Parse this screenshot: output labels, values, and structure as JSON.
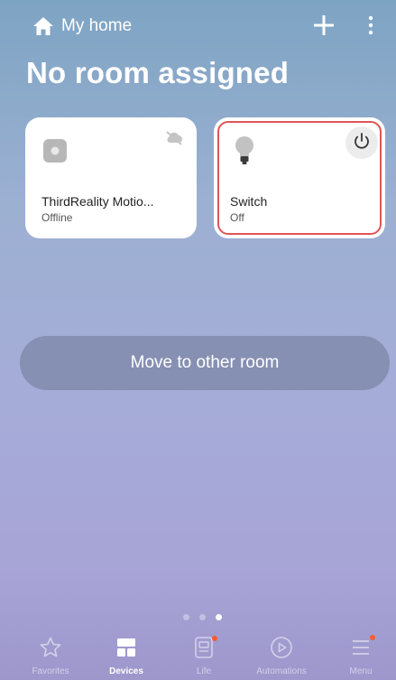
{
  "header": {
    "home_label": "My home",
    "title": "No room assigned"
  },
  "devices": [
    {
      "name": "ThirdReality Motio...",
      "status": "Offline",
      "icon": "sensor-icon"
    },
    {
      "name": "Switch",
      "status": "Off",
      "icon": "bulb-icon"
    }
  ],
  "actions": {
    "move_label": "Move to other room"
  },
  "pager": {
    "pages": 3,
    "current": 3
  },
  "nav": [
    {
      "label": "Favorites",
      "icon": "star-icon"
    },
    {
      "label": "Devices",
      "icon": "devices-icon"
    },
    {
      "label": "Life",
      "icon": "life-icon"
    },
    {
      "label": "Automations",
      "icon": "automations-icon"
    },
    {
      "label": "Menu",
      "icon": "menu-icon"
    }
  ],
  "colors": {
    "highlight": "#e05555",
    "badge": "#ff5a2c"
  }
}
